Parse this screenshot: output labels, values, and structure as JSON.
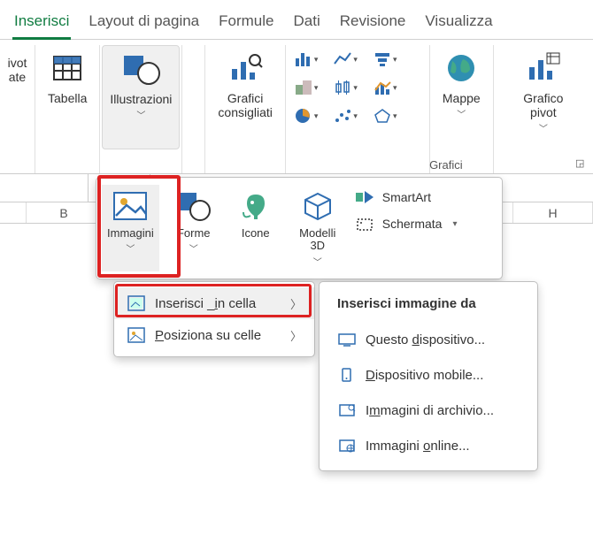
{
  "tabs": {
    "inserisci": "Inserisci",
    "layout": "Layout di pagina",
    "formule": "Formule",
    "dati": "Dati",
    "revisione": "Revisione",
    "visualizza": "Visualizza"
  },
  "ribbon": {
    "pivot": "ivot\nate",
    "tabella": "Tabella",
    "illustrazioni": "Illustrazioni",
    "grafici_cons": "Grafici\nconsigliati",
    "mappe": "Mappe",
    "grafico_pivot": "Grafico\npivot",
    "grafici_group": "Grafici"
  },
  "illus": {
    "immagini": "Immagini",
    "forme": "Forme",
    "icone": "Icone",
    "modelli3d": "Modelli\n3D",
    "smartart": "SmartArt",
    "schermata": "Schermata"
  },
  "menu1": {
    "in_cella": "Inserisci _in cella",
    "su_celle": "Posiziona su celle"
  },
  "menu2": {
    "title": "Inserisci immagine da",
    "device": "Questo dispositivo...",
    "mobile": "Dispositivo mobile...",
    "stock": "Immagini di archivio...",
    "online": "Immagini online..."
  },
  "cols": {
    "b": "B",
    "h": "H"
  }
}
